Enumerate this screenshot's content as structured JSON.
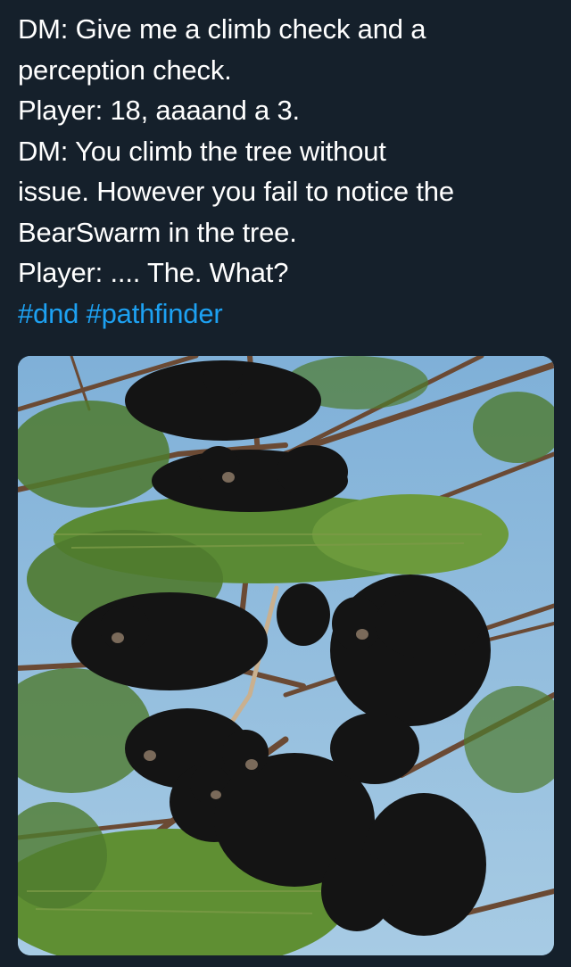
{
  "tweet": {
    "lines": [
      "DM: Give me a climb check and a",
      "perception check.",
      "Player: 18, aaaand a 3.",
      "DM: You climb the tree without",
      "issue. However you fail to notice the",
      "BearSwarm in the tree.",
      "Player: .... The. What?"
    ],
    "hashtags": [
      "#dnd",
      "#pathfinder"
    ]
  },
  "media": {
    "colors": {
      "sky": "#8ab6d8",
      "foliage": "#4f7a2e",
      "bear": "#141414",
      "branch": "#6b4a34"
    }
  },
  "theme": {
    "background": "#15202b",
    "text": "#ffffff",
    "hashtag": "#1da1f2"
  }
}
